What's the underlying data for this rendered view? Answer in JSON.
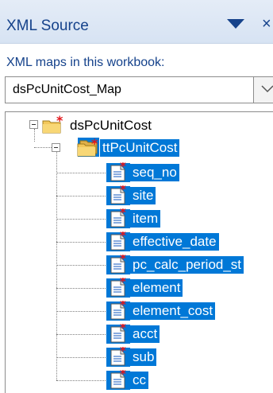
{
  "panel": {
    "title": "XML Source",
    "close_glyph": "×",
    "menu_icon": "dropdown-triangle-icon"
  },
  "maps": {
    "label": "XML maps in this workbook:",
    "selected": "dsPcUnitCost_Map"
  },
  "tree": {
    "root": {
      "label": "dsPcUnitCost",
      "icon": "folder-required-icon",
      "expanded": true
    },
    "table": {
      "label": "ttPcUnitCost",
      "icon": "repeating-folder-icon",
      "expanded": true,
      "selected": true
    },
    "fields": [
      {
        "label": "seq_no",
        "icon": "required-element-icon"
      },
      {
        "label": "site",
        "icon": "required-element-icon"
      },
      {
        "label": "item",
        "icon": "required-element-icon"
      },
      {
        "label": "effective_date",
        "icon": "required-element-icon"
      },
      {
        "label": "pc_calc_period_st",
        "icon": "required-element-icon"
      },
      {
        "label": "element",
        "icon": "required-element-icon"
      },
      {
        "label": "element_cost",
        "icon": "required-element-icon"
      },
      {
        "label": "acct",
        "icon": "required-element-icon"
      },
      {
        "label": "sub",
        "icon": "required-element-icon"
      },
      {
        "label": "cc",
        "icon": "required-element-icon"
      }
    ]
  },
  "colors": {
    "title_text": "#15428b",
    "selection": "#0078d7",
    "required_star": "#e3151a"
  }
}
